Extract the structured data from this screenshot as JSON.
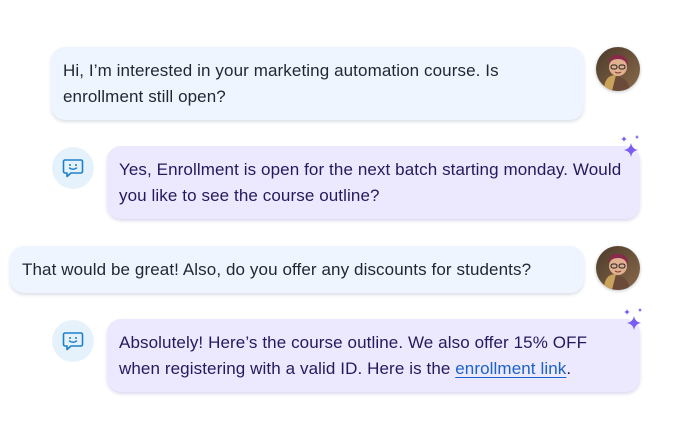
{
  "conversation": {
    "messages": [
      {
        "role": "user",
        "text": "Hi, I’m interested in your marketing automation course. Is enrollment still open?"
      },
      {
        "role": "bot",
        "text": "Yes, Enrollment is open for the next batch starting monday. Would you like to see the course outline?"
      },
      {
        "role": "user",
        "text": "That would be great! Also, do you offer any discounts for students?"
      },
      {
        "role": "bot",
        "text_before_link": "Absolutely! Here’s the course outline. We also offer 15% OFF when registering with a valid ID. Here is the ",
        "link_text": "enrollment link",
        "text_after_link": "."
      }
    ]
  },
  "icons": {
    "user_avatar": "user-avatar-photo",
    "bot_icon": "chat-smiley-icon",
    "ai_sparkle": "sparkle-icon"
  },
  "colors": {
    "user_bubble": "#eef5fe",
    "bot_bubble": "#ece8fe",
    "bot_text": "#241a5c",
    "link": "#1a63c7",
    "sparkle": "#7b5cf0",
    "bot_icon": "#1e80c8"
  }
}
